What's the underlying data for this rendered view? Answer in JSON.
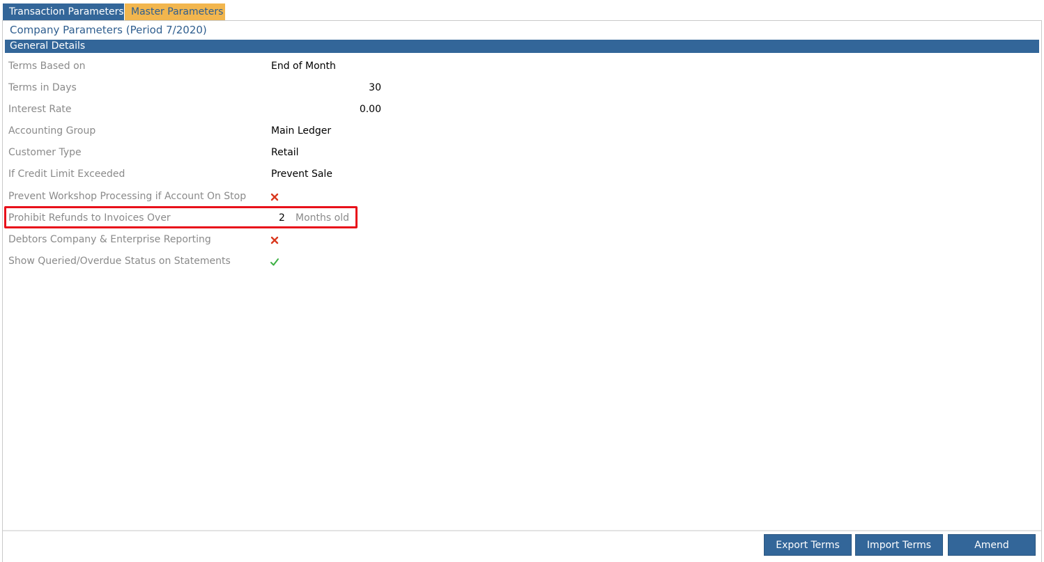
{
  "tabs": [
    {
      "label": "Transaction Parameters",
      "active": true
    },
    {
      "label": "Master Parameters",
      "active": false
    }
  ],
  "page_title": "Company Parameters (Period 7/2020)",
  "section": {
    "title": "General Details"
  },
  "fields": {
    "terms_based_on": {
      "label": "Terms Based on",
      "value": "End of Month"
    },
    "terms_in_days": {
      "label": "Terms in Days",
      "value": "30"
    },
    "interest_rate": {
      "label": "Interest Rate",
      "value": "0.00"
    },
    "accounting_group": {
      "label": "Accounting Group",
      "value": "Main Ledger"
    },
    "customer_type": {
      "label": "Customer Type",
      "value": "Retail"
    },
    "credit_limit": {
      "label": "If Credit Limit Exceeded",
      "value": "Prevent Sale"
    },
    "prevent_workshop": {
      "label": "Prevent Workshop Processing if Account On Stop",
      "value": false,
      "icon": "cross-icon"
    },
    "prohibit_refunds": {
      "label": "Prohibit Refunds to Invoices Over",
      "value": "2",
      "unit": "Months old"
    },
    "debtors_reporting": {
      "label": "Debtors Company & Enterprise Reporting",
      "value": false,
      "icon": "cross-icon"
    },
    "show_queried": {
      "label": "Show Queried/Overdue Status on Statements",
      "value": true,
      "icon": "check-icon"
    }
  },
  "buttons": {
    "export": "Export Terms",
    "import": "Import Terms",
    "amend": "Amend"
  },
  "colors": {
    "primary": "#336699",
    "tab_inactive": "#f2b64e",
    "highlight": "#e8101a",
    "label_text": "#8a8a8a",
    "cross": "#d9381e",
    "check": "#3cb043"
  }
}
